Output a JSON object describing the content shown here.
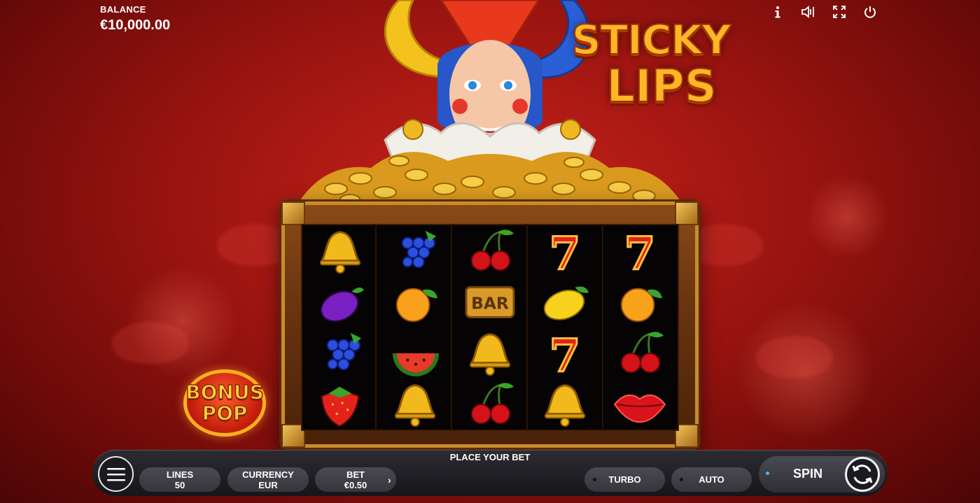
{
  "balance": {
    "label": "BALANCE",
    "value": "€10,000.00"
  },
  "top_icons": [
    "info-icon",
    "sound-icon",
    "fullscreen-icon",
    "power-icon"
  ],
  "title": {
    "line1": "STICKY",
    "line2": "LIPS"
  },
  "bonus_pop": {
    "line1": "BONUS",
    "line2": "POP"
  },
  "reels": {
    "symbols": [
      [
        "bell",
        "grapes",
        "cherry",
        "seven",
        "seven"
      ],
      [
        "plum",
        "orange",
        "bar",
        "lemon",
        "orange"
      ],
      [
        "grapes",
        "watermelon",
        "bell",
        "seven",
        "cherry"
      ],
      [
        "strawberry",
        "bell",
        "cherry",
        "bell",
        "lips"
      ]
    ],
    "bar_text": "BAR"
  },
  "bottom_bar": {
    "status": "PLACE YOUR BET",
    "lines": {
      "label": "LINES",
      "value": "50"
    },
    "currency": {
      "label": "CURRENCY",
      "value": "EUR"
    },
    "bet": {
      "label": "BET",
      "value": "€0.50"
    },
    "turbo_label": "TURBO",
    "auto_label": "AUTO",
    "spin_label": "SPIN"
  },
  "colors": {
    "background": "#9a1410",
    "accent_gold": "#ffb627",
    "bar_dark": "#15151a",
    "spin_indicator": "#4ab4ff"
  }
}
